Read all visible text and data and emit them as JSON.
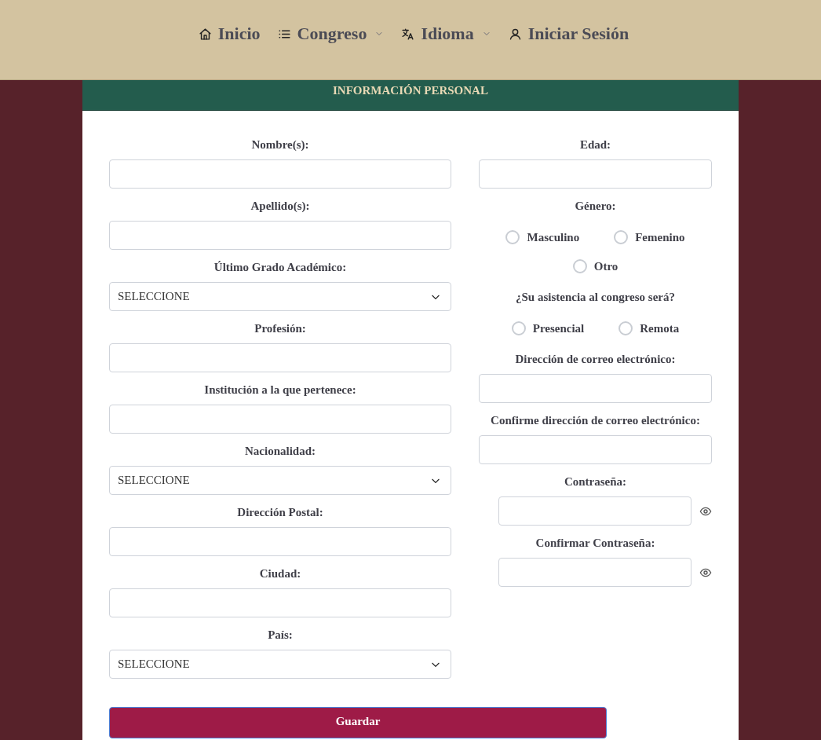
{
  "nav": [
    {
      "label": "Inicio",
      "dropdown": false
    },
    {
      "label": "Congreso",
      "dropdown": true
    },
    {
      "label": "Idioma",
      "dropdown": true
    },
    {
      "label": "Iniciar Sesión",
      "dropdown": false
    }
  ],
  "section_title": "INFORMACIÓN PERSONAL",
  "left_fields": [
    {
      "kind": "text",
      "label": "Nombre(s):"
    },
    {
      "kind": "text",
      "label": "Apellido(s):"
    },
    {
      "kind": "select",
      "label": "Último Grado Académico:",
      "value": "SELECCIONE"
    },
    {
      "kind": "text",
      "label": "Profesión:"
    },
    {
      "kind": "text",
      "label": "Institución a la que pertenece:"
    },
    {
      "kind": "select",
      "label": "Nacionalidad:",
      "value": "SELECCIONE"
    },
    {
      "kind": "text",
      "label": "Dirección Postal:"
    },
    {
      "kind": "text",
      "label": "Ciudad:"
    },
    {
      "kind": "select",
      "label": "País:",
      "value": "SELECCIONE"
    }
  ],
  "right_fields": [
    {
      "kind": "text",
      "label": "Edad:"
    },
    {
      "kind": "radio",
      "label": "Género:",
      "options": [
        {
          "label": "Masculino",
          "selected": false
        },
        {
          "label": "Femenino",
          "selected": false
        },
        {
          "label": "Otro",
          "selected": false
        }
      ]
    },
    {
      "kind": "radio",
      "label": "¿Su asistencia al congreso será?",
      "options": [
        {
          "label": "Presencial",
          "selected": false
        },
        {
          "label": "Remota",
          "selected": false
        }
      ]
    },
    {
      "kind": "text",
      "label": "Dirección de correo electrónico:"
    },
    {
      "kind": "text",
      "label": "Confirme dirección de correo electrónico:"
    },
    {
      "kind": "password",
      "label": "Contraseña:"
    },
    {
      "kind": "password",
      "label": "Confirmar Contraseña:"
    }
  ],
  "submit_button": "Guardar"
}
